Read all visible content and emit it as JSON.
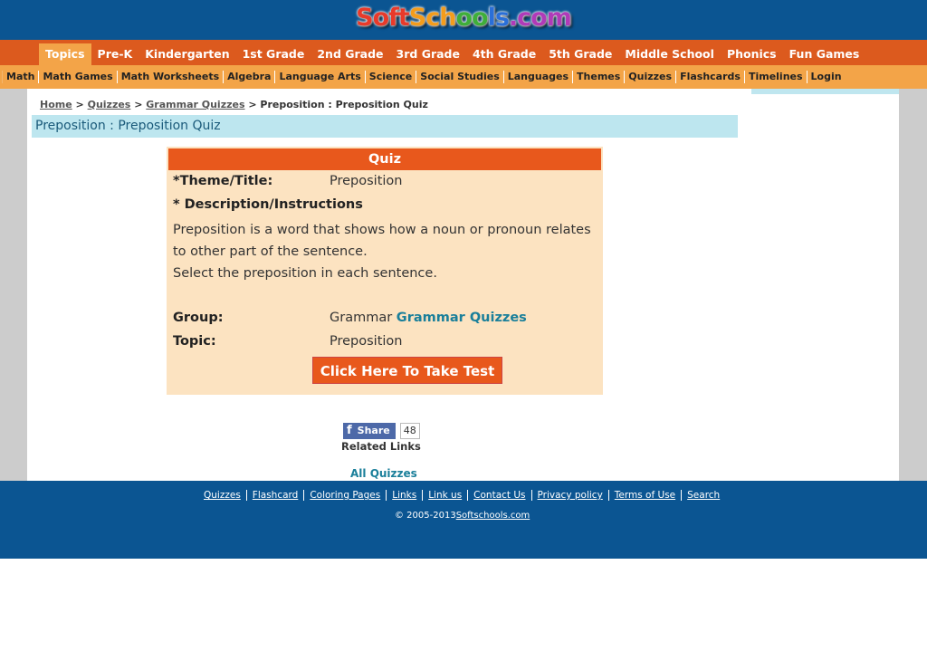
{
  "logo": {
    "parts": [
      "Soft",
      "Sch",
      "oo",
      "ls",
      ".com"
    ]
  },
  "nav_primary": [
    "Topics",
    "Pre-K",
    "Kindergarten",
    "1st Grade",
    "2nd Grade",
    "3rd Grade",
    "4th Grade",
    "5th Grade",
    "Middle School",
    "Phonics",
    "Fun Games"
  ],
  "nav_secondary": [
    "Math",
    "Math Games",
    "Math Worksheets",
    "Algebra",
    "Language Arts",
    "Science",
    "Social Studies",
    "Languages",
    "Themes",
    "Quizzes",
    "Flashcards",
    "Timelines",
    "Login"
  ],
  "breadcrumb": {
    "home": "Home",
    "sep": ">",
    "quizzes": "Quizzes",
    "grammar": "Grammar Quizzes",
    "current": "> Preposition : Preposition Quiz"
  },
  "page_title": "Preposition : Preposition Quiz",
  "quiz": {
    "header": "Quiz",
    "theme_label": "*Theme/Title:",
    "theme_value": "Preposition",
    "desc_label": "* Description/Instructions",
    "desc_line1": "Preposition is a word that shows how a noun or pronoun relates to other part of the sentence.",
    "desc_line2": "Select the preposition in each sentence.",
    "group_label": "Group:",
    "group_value": "Grammar",
    "group_link": "Grammar Quizzes",
    "topic_label": "Topic:",
    "topic_value": "Preposition",
    "button": "Click Here To Take Test"
  },
  "share": {
    "icon": "f",
    "label": "Share",
    "count": "48"
  },
  "related_links": "Related Links",
  "all_quizzes": "All Quizzes",
  "footer": {
    "links": [
      "Quizzes",
      "Flashcard",
      "Coloring Pages",
      "Links",
      "Link us",
      "Contact Us",
      "Privacy policy",
      "Terms of Use",
      "Search"
    ],
    "copyright": "© 2005-2013",
    "site": "Softschools.com"
  }
}
